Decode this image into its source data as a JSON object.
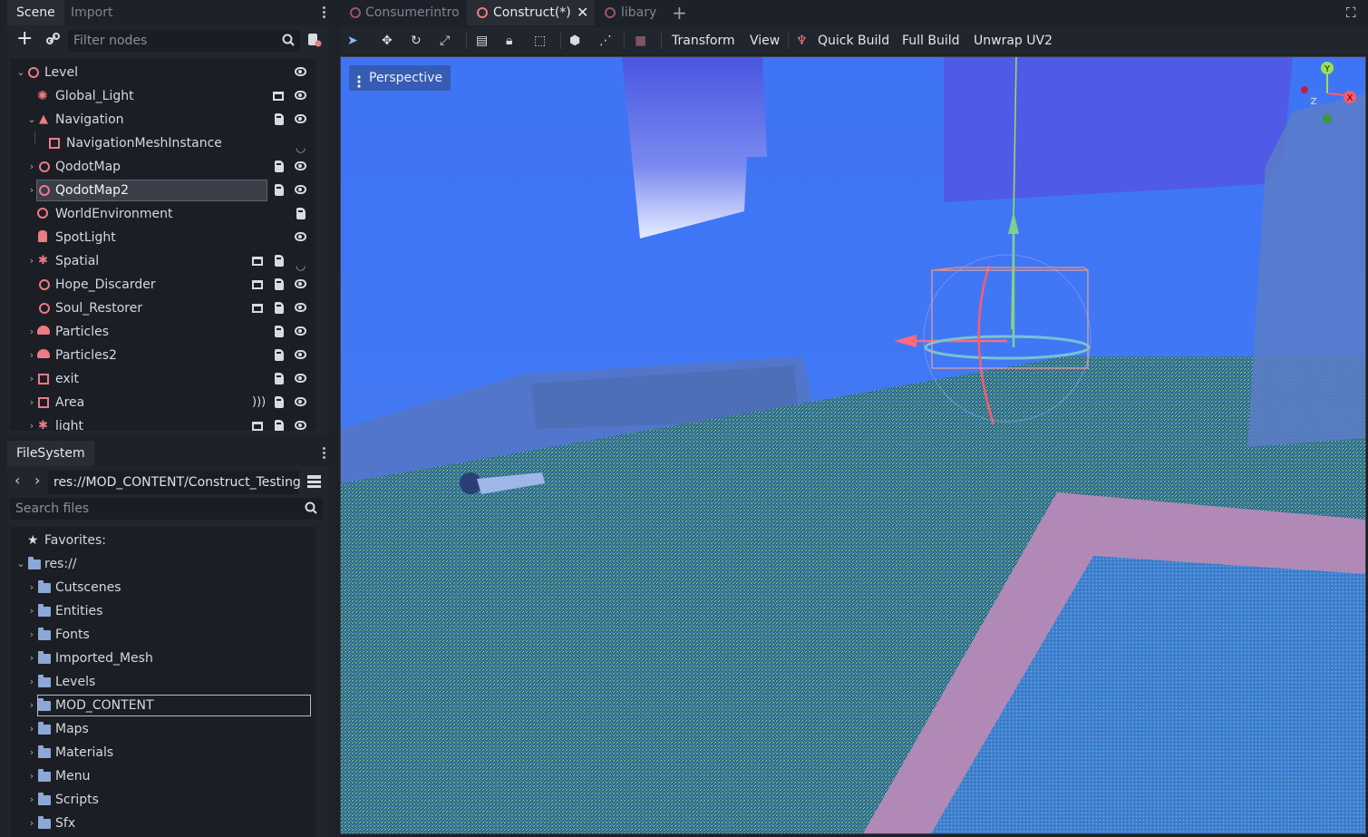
{
  "scene_dock": {
    "tabs": [
      "Scene",
      "Import"
    ],
    "filter_placeholder": "Filter nodes",
    "nodes": [
      {
        "label": "Level"
      },
      {
        "label": "Global_Light"
      },
      {
        "label": "Navigation"
      },
      {
        "label": "NavigationMeshInstance"
      },
      {
        "label": "QodotMap"
      },
      {
        "label": "QodotMap2"
      },
      {
        "label": "WorldEnvironment"
      },
      {
        "label": "SpotLight"
      },
      {
        "label": "Spatial"
      },
      {
        "label": "Hope_Discarder"
      },
      {
        "label": "Soul_Restorer"
      },
      {
        "label": "Particles"
      },
      {
        "label": "Particles2"
      },
      {
        "label": "exit"
      },
      {
        "label": "Area"
      },
      {
        "label": "light"
      }
    ]
  },
  "filesystem_dock": {
    "tab": "FileSystem",
    "path": "res://MOD_CONTENT/Construct_Testing",
    "search_placeholder": "Search files",
    "favorites_label": "Favorites:",
    "root_label": "res://",
    "folders": [
      "Cutscenes",
      "Entities",
      "Fonts",
      "Imported_Mesh",
      "Levels",
      "MOD_CONTENT",
      "Maps",
      "Materials",
      "Menu",
      "Scripts",
      "Sfx"
    ]
  },
  "scene_tabs": [
    "Consumerintro",
    "Construct(*)",
    "libary"
  ],
  "toolbar": {
    "menus": [
      "Transform",
      "View"
    ],
    "quick_build": "Quick Build",
    "full_build": "Full Build",
    "unwrap_uv2": "Unwrap UV2"
  },
  "viewport": {
    "perspective_label": "Perspective",
    "gizmo_axes": {
      "x": "X",
      "y": "Y",
      "z": "Z"
    }
  },
  "colors": {
    "accent": "#f07a82",
    "panel_bg": "#21252d",
    "viewport_sky": "#3f7bff",
    "floor": "#2f5a8a"
  }
}
